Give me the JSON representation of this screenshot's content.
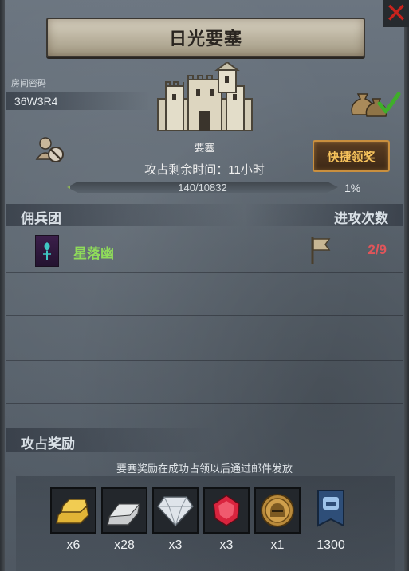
{
  "header": {
    "title": "日光要塞",
    "close_icon": "close-icon"
  },
  "room": {
    "label": "房间密码",
    "code": "36W3R4"
  },
  "fortress": {
    "label": "要塞",
    "timer_text": "攻占剩余时间：11小时",
    "progress_text": "140/10832",
    "progress_current": 140,
    "progress_total": 10832,
    "progress_percent_label": "1%",
    "quick_claim_label": "快捷领奖"
  },
  "mercenary": {
    "section_title": "佣兵团",
    "attack_count_title": "进攻次数",
    "rows": [
      {
        "name": "星落幽",
        "attack_count": "2/9"
      }
    ]
  },
  "rewards": {
    "title": "攻占奖励",
    "note": "要塞奖励在成功占领以后通过邮件发放",
    "items": [
      {
        "icon": "gold-bar-icon",
        "qty": "x6"
      },
      {
        "icon": "silver-bar-icon",
        "qty": "x28"
      },
      {
        "icon": "diamond-icon",
        "qty": "x3"
      },
      {
        "icon": "ruby-icon",
        "qty": "x3"
      },
      {
        "icon": "helmet-coin-icon",
        "qty": "x1"
      },
      {
        "icon": "guild-banner-icon",
        "qty": "1300"
      }
    ]
  },
  "colors": {
    "accent_gold": "#f6c25c",
    "merc_name_green": "#8fdc5a",
    "attack_count_red": "#e0555a",
    "close_red": "#c8231d"
  }
}
